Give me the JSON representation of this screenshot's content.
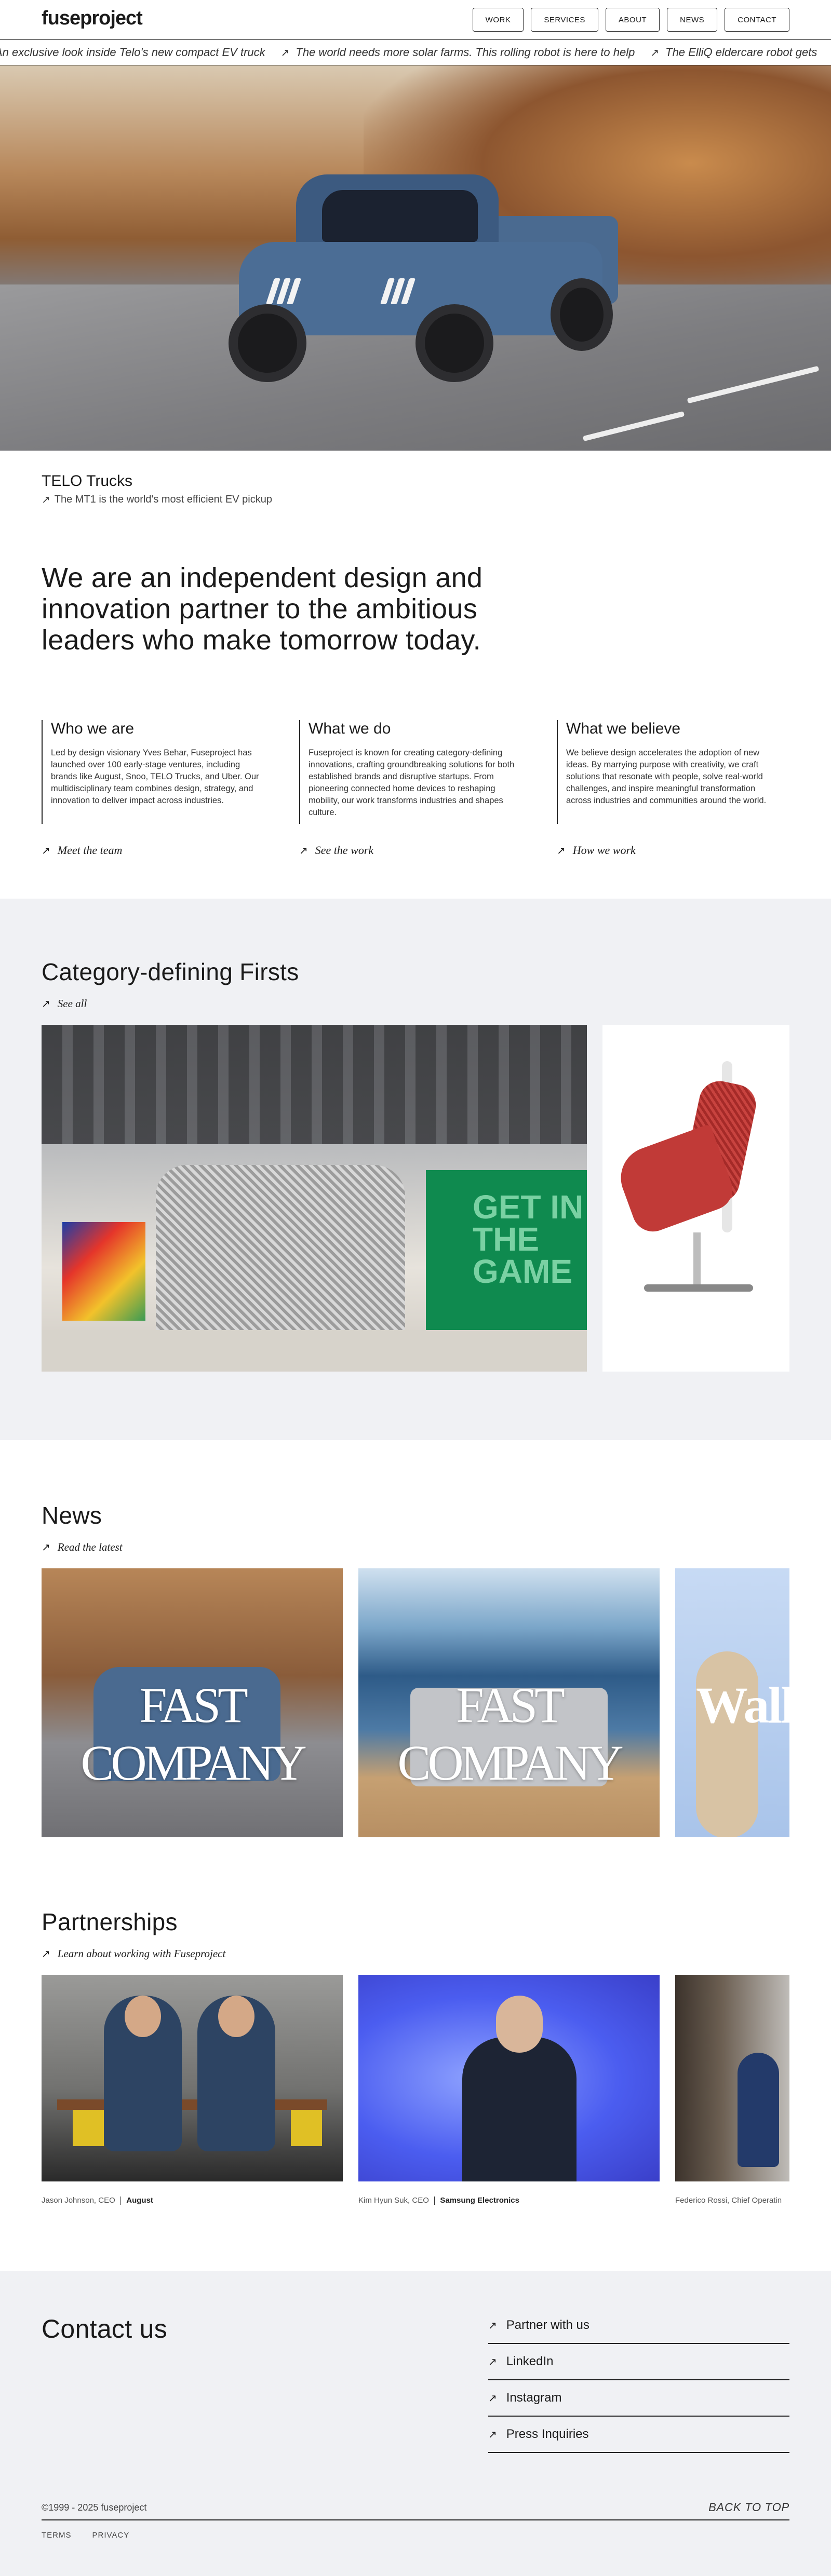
{
  "header": {
    "logo": "fuseproject",
    "nav": [
      "WORK",
      "SERVICES",
      "ABOUT",
      "NEWS",
      "CONTACT"
    ]
  },
  "ticker": [
    "An exclusive look inside Telo's new compact EV truck",
    "The world needs more solar farms. This rolling robot is here to help",
    "The ElliQ eldercare robot gets"
  ],
  "hero": {
    "title": "TELO Trucks",
    "subtitle": "The MT1 is the world's most efficient EV pickup"
  },
  "intro": "We are an independent design and innovation partner to the ambitious leaders who make tomorrow today.",
  "columns": [
    {
      "title": "Who we are",
      "text": "Led by design visionary Yves Behar, Fuseproject has launched over 100 early-stage ventures, including brands like August, Snoo, TELO Trucks, and Uber. Our multidisciplinary team combines design, strategy, and innovation to deliver impact across industries.",
      "link": "Meet the team"
    },
    {
      "title": "What we do",
      "text": "Fuseproject is known for creating category-defining innovations, crafting groundbreaking solutions for both established brands and disruptive startups. From pioneering connected home devices to reshaping mobility, our work transforms industries and shapes culture.",
      "link": "See the work"
    },
    {
      "title": "What we believe",
      "text": "We believe design accelerates the adoption of new ideas. By marrying purpose with creativity, we craft solutions that resonate with people, solve real-world challenges, and inspire meaningful transformation across industries and communities around the world.",
      "link": "How we work"
    }
  ],
  "firsts": {
    "title": "Category-defining Firsts",
    "link": "See all",
    "gallery_sign": "GET IN THE GAME"
  },
  "news": {
    "title": "News",
    "link": "Read the latest",
    "cards": [
      "FAST COMPANY",
      "FAST COMPANY",
      "Wall"
    ]
  },
  "partnerships": {
    "title": "Partnerships",
    "link": "Learn about working with Fuseproject",
    "cards": [
      {
        "person": "Jason Johnson, CEO",
        "company": "August"
      },
      {
        "person": "Kim Hyun Suk, CEO",
        "company": "Samsung Electronics"
      },
      {
        "person": "Federico Rossi, Chief Operatin",
        "company": ""
      }
    ]
  },
  "contact": {
    "title": "Contact us",
    "links": [
      "Partner with us",
      "LinkedIn",
      "Instagram",
      "Press Inquiries"
    ],
    "copyright": "©1999 - 2025 fuseproject",
    "back_to_top": "BACK TO TOP",
    "legal": [
      "TERMS",
      "PRIVACY"
    ]
  },
  "icons": {
    "arrow": "arrow-up-right-icon"
  },
  "colors": {
    "gray_section": "#f0f1f4",
    "green_wall": "#0f8a4f",
    "text": "#1a1a1a"
  }
}
